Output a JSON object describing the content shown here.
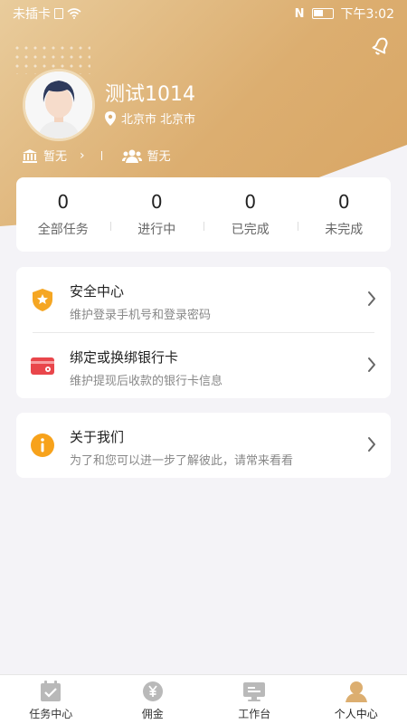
{
  "status_bar": {
    "carrier": "未插卡",
    "time": "下午3:02"
  },
  "profile": {
    "name": "测试1014",
    "location": "北京市 北京市",
    "bank_status": "暂无",
    "team_status": "暂无"
  },
  "stats": [
    {
      "value": "0",
      "label": "全部任务"
    },
    {
      "value": "0",
      "label": "进行中"
    },
    {
      "value": "0",
      "label": "已完成"
    },
    {
      "value": "0",
      "label": "未完成"
    }
  ],
  "menu": {
    "security": {
      "title": "安全中心",
      "subtitle": "维护登录手机号和登录密码"
    },
    "bank_card": {
      "title": "绑定或换绑银行卡",
      "subtitle": "维护提现后收款的银行卡信息"
    },
    "about": {
      "title": "关于我们",
      "subtitle": "为了和您可以进一步了解彼此，请常来看看"
    }
  },
  "tabs": [
    {
      "label": "任务中心",
      "icon": "calendar-check-icon"
    },
    {
      "label": "佣金",
      "icon": "yen-coin-icon"
    },
    {
      "label": "工作台",
      "icon": "monitor-icon"
    },
    {
      "label": "个人中心",
      "icon": "person-icon"
    }
  ],
  "colors": {
    "accent_gold": "#dcae70",
    "security_orange": "#f5a623",
    "card_red": "#e9464b",
    "info_orange": "#f7a21b"
  }
}
